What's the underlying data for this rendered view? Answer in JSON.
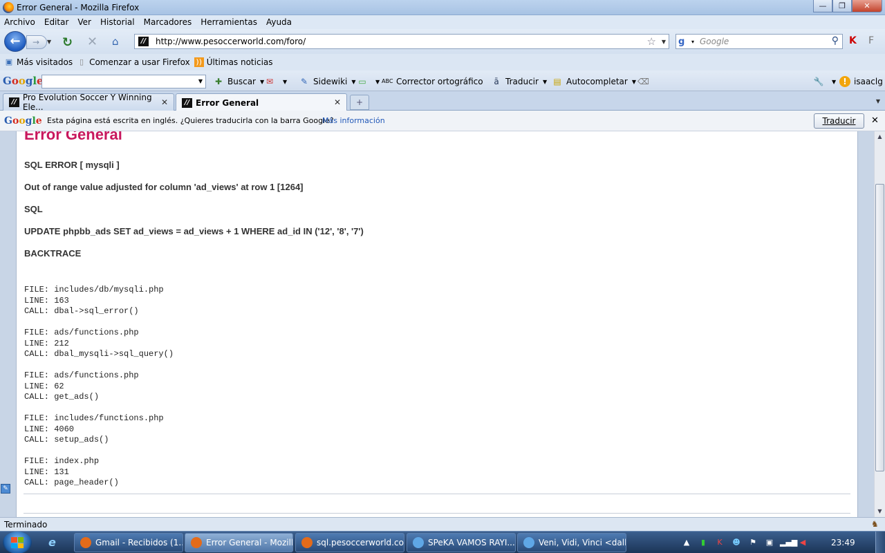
{
  "window": {
    "title": "Error General - Mozilla Firefox",
    "buttons": {
      "minimize": "—",
      "maximize": "❐",
      "close": "✕"
    }
  },
  "menu": [
    "Archivo",
    "Editar",
    "Ver",
    "Historial",
    "Marcadores",
    "Herramientas",
    "Ayuda"
  ],
  "nav": {
    "url": "http://www.pesoccerworld.com/foro/",
    "search_placeholder": "Google"
  },
  "bookmarks": [
    {
      "label": "Más visitados",
      "icon": "most-visited-icon"
    },
    {
      "label": "Comenzar a usar Firefox",
      "icon": "page-icon"
    },
    {
      "label": "Últimas noticias",
      "icon": "rss-icon"
    }
  ],
  "google_toolbar": {
    "buscar": "Buscar",
    "sidewiki": "Sidewiki",
    "corrector": "Corrector ortográfico",
    "traducir": "Traducir",
    "autocompletar": "Autocompletar",
    "user": "isaaclg"
  },
  "tabs": [
    {
      "label": "Pro Evolution Soccer Y Winning Ele...",
      "active": false
    },
    {
      "label": "Error General",
      "active": true
    }
  ],
  "translate_bar": {
    "message": "Esta página está escrita en inglés. ¿Quieres traducirla con la barra Google?",
    "more_info": "Más información",
    "button": "Traducir"
  },
  "page": {
    "title": "Error General",
    "sql_error": "SQL ERROR [ mysqli ]",
    "message": "Out of range value adjusted for column 'ad_views' at row 1 [1264]",
    "sql_label": "SQL",
    "query": "UPDATE phpbb_ads SET ad_views = ad_views + 1 WHERE ad_id IN ('12', '8', '7')",
    "backtrace_label": "BACKTRACE",
    "backtrace": [
      {
        "file": "FILE: includes/db/mysqli.php",
        "line": "LINE: 163",
        "call": "CALL: dbal->sql_error()"
      },
      {
        "file": "FILE: ads/functions.php",
        "line": "LINE: 212",
        "call": "CALL: dbal_mysqli->sql_query()"
      },
      {
        "file": "FILE: ads/functions.php",
        "line": "LINE: 62",
        "call": "CALL: get_ads()"
      },
      {
        "file": "FILE: includes/functions.php",
        "line": "LINE: 4060",
        "call": "CALL: setup_ads()"
      },
      {
        "file": "FILE: index.php",
        "line": "LINE: 131",
        "call": "CALL: page_header()"
      }
    ]
  },
  "status": "Terminado",
  "taskbar": {
    "tasks": [
      {
        "label": "Gmail - Recibidos (1...",
        "active": false,
        "icon_color": "#e46b1a"
      },
      {
        "label": "Error General - Mozill...",
        "active": true,
        "icon_color": "#e46b1a"
      },
      {
        "label": "sql.pesoccerworld.co...",
        "active": false,
        "icon_color": "#e46b1a"
      },
      {
        "label": "SPeKA VAMOS RAYI...",
        "active": false,
        "icon_color": "#5fa7e6"
      },
      {
        "label": "Veni, Vidi, Vinci <dall...",
        "active": false,
        "icon_color": "#5fa7e6"
      }
    ],
    "clock": "23:49"
  }
}
